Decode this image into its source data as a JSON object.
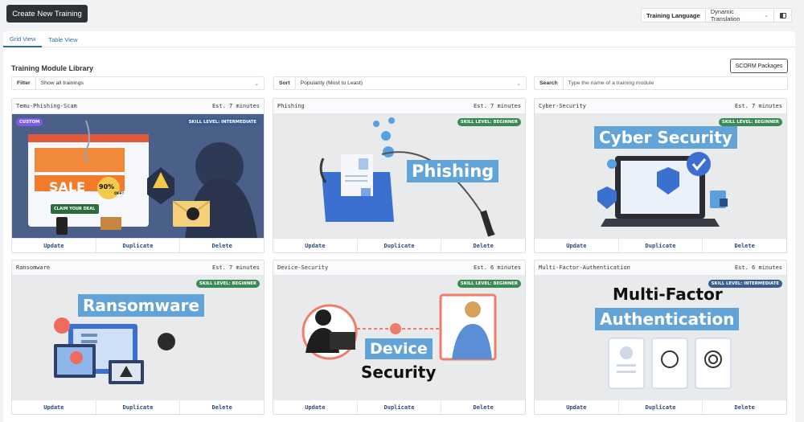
{
  "toolbar": {
    "create_label": "Create New Training"
  },
  "language": {
    "label": "Training Language",
    "value": "Dynamic Translation"
  },
  "tabs": [
    {
      "label": "Grid View"
    },
    {
      "label": "Table View"
    }
  ],
  "library": {
    "title": "Training Module Library",
    "scorm_label": "SCORM Packages",
    "filter": {
      "label": "Filter",
      "value": "Show all trainings"
    },
    "sort": {
      "label": "Sort",
      "value": "Popularity (Most to Least)"
    },
    "search": {
      "label": "Search",
      "placeholder": "Type the name of a training module"
    }
  },
  "cards": [
    {
      "title": "Temu-Phishing-Scam",
      "duration": "Est. 7 minutes",
      "badge": "SKILL LEVEL: INTERMEDIATE",
      "custom": "CUSTOM",
      "art": {
        "sale": "SALE",
        "pct": "90%",
        "off": "OFF!",
        "claim": "CLAIM YOUR DEAL"
      }
    },
    {
      "title": "Phishing",
      "duration": "Est. 7 minutes",
      "badge": "SKILL LEVEL: BEGINNER",
      "art": {
        "banner": "Phishing"
      }
    },
    {
      "title": "Cyber-Security",
      "duration": "Est. 7 minutes",
      "badge": "SKILL LEVEL: BEGINNER",
      "art": {
        "banner": "Cyber Security"
      }
    },
    {
      "title": "Ransomware",
      "duration": "Est. 7 minutes",
      "badge": "SKILL LEVEL: BEGINNER",
      "art": {
        "banner": "Ransomware"
      }
    },
    {
      "title": "Device-Security",
      "duration": "Est. 6 minutes",
      "badge": "SKILL LEVEL: BEGINNER",
      "art": {
        "banner": "Device",
        "sub": "Security"
      }
    },
    {
      "title": "Multi-Factor-Authentication",
      "duration": "Est. 6 minutes",
      "badge": "SKILL LEVEL: INTERMEDIATE",
      "art": {
        "line1": "Multi-Factor",
        "banner": "Authentication"
      }
    }
  ],
  "actions": {
    "update": "Update",
    "duplicate": "Duplicate",
    "delete": "Delete"
  },
  "colors": {
    "accent": "#2b6cb0",
    "beginner": "#3b8a55",
    "intermediate": "#3a5d8f",
    "custom": "#7c5ce8",
    "banner": "#62a3d8"
  }
}
